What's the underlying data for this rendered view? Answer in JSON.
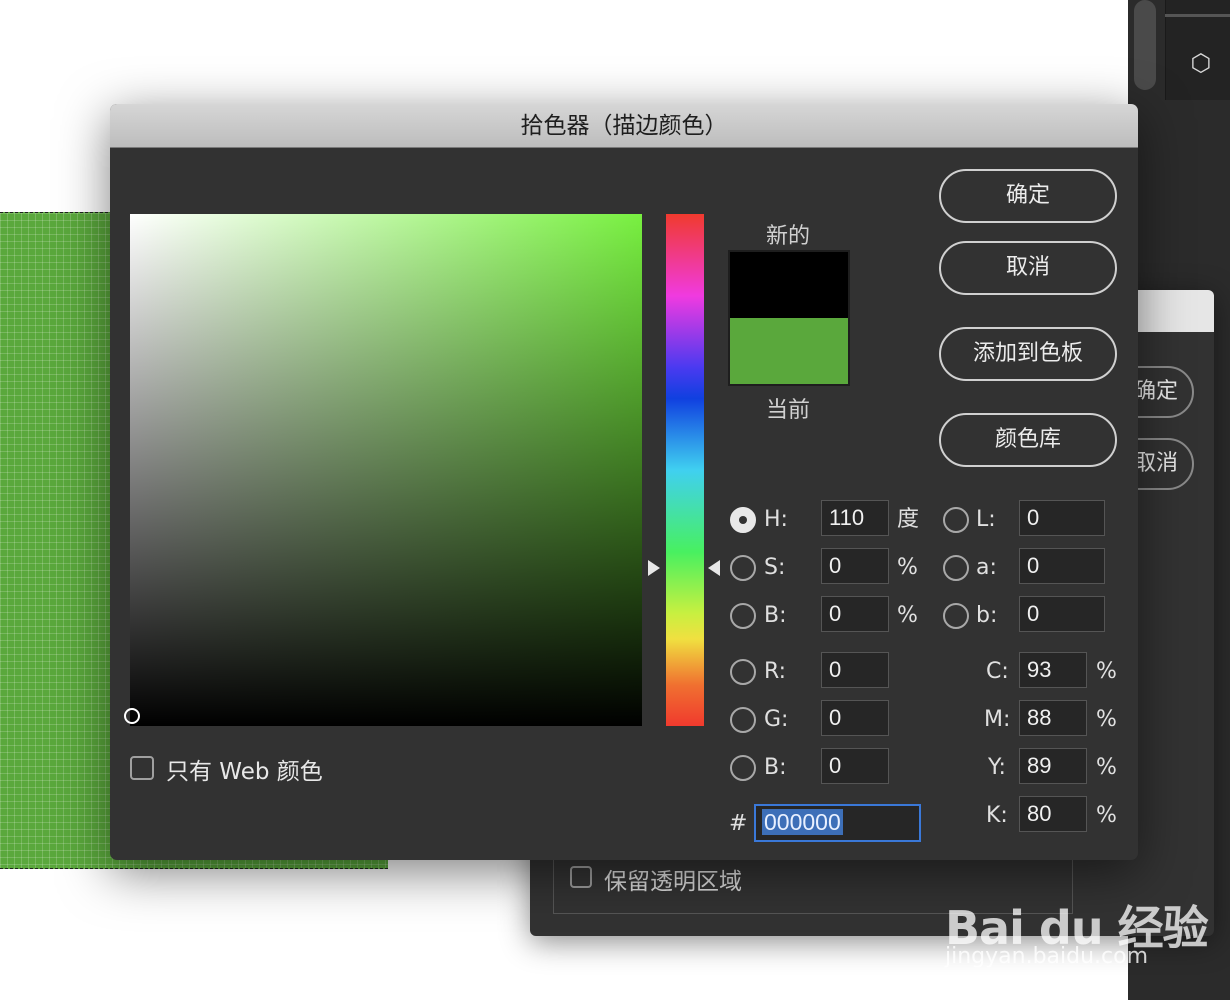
{
  "dialog": {
    "title": "拾色器（描边颜色）",
    "buttons": {
      "ok": "确定",
      "cancel": "取消",
      "add_swatch": "添加到色板",
      "color_libraries": "颜色库"
    },
    "swatch": {
      "new_label": "新的",
      "current_label": "当前",
      "new_color": "#000000",
      "current_color": "#5aa83c"
    },
    "fields": {
      "H": {
        "label": "H:",
        "value": "110",
        "unit": "度"
      },
      "S": {
        "label": "S:",
        "value": "0",
        "unit": "%"
      },
      "B_hsb": {
        "label": "B:",
        "value": "0",
        "unit": "%"
      },
      "R": {
        "label": "R:",
        "value": "0"
      },
      "G": {
        "label": "G:",
        "value": "0"
      },
      "B_rgb": {
        "label": "B:",
        "value": "0"
      },
      "L": {
        "label": "L:",
        "value": "0"
      },
      "a": {
        "label": "a:",
        "value": "0"
      },
      "b": {
        "label": "b:",
        "value": "0"
      },
      "C": {
        "label": "C:",
        "value": "93",
        "unit": "%"
      },
      "M": {
        "label": "M:",
        "value": "88",
        "unit": "%"
      },
      "Y": {
        "label": "Y:",
        "value": "89",
        "unit": "%"
      },
      "K": {
        "label": "K:",
        "value": "80",
        "unit": "%"
      }
    },
    "selected_mode": "H",
    "hex": {
      "label": "#",
      "value": "000000"
    },
    "web_only": {
      "label": "只有 Web 颜色",
      "checked": false
    }
  },
  "background_dialog": {
    "buttons": {
      "ok": "确定",
      "cancel": "取消"
    },
    "preserve_transparency": {
      "label": "保留透明区域",
      "checked": false
    }
  },
  "watermark": {
    "logo": "Bai du 经验",
    "url": "jingyan.baidu.com"
  },
  "icons": {
    "toolbar_cube": "cube-icon"
  },
  "colors": {
    "accent": "#3a78d8",
    "canvas_green": "#5aa83c",
    "dialog_bg": "#323232"
  }
}
